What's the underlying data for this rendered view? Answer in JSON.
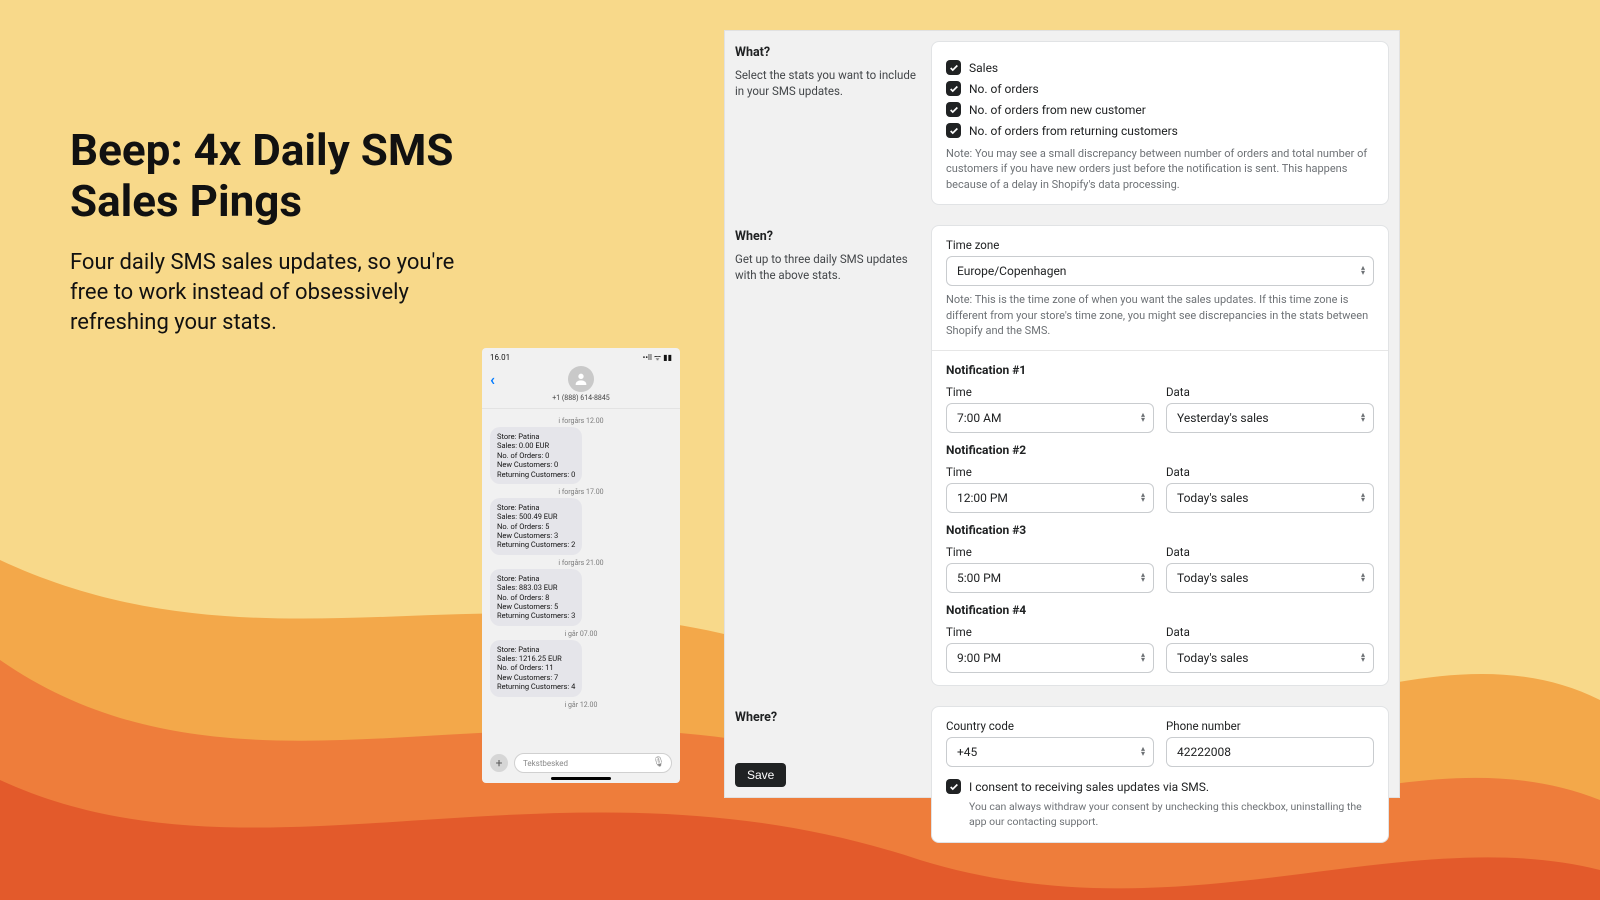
{
  "hero": {
    "title": "Beep: 4x Daily SMS Sales Pings",
    "subtitle": "Four daily SMS sales updates, so you're free to work instead of obsessively refreshing your stats."
  },
  "phone": {
    "status_time": "16.01",
    "number": "+1 (888) 614-8845",
    "input_placeholder": "Tekstbesked",
    "messages": [
      {
        "divider": "i forgårs 12.00",
        "lines": [
          "Store: Patina",
          "Sales: 0.00 EUR",
          "No. of Orders: 0",
          "New Customers: 0",
          "Returning Customers: 0"
        ]
      },
      {
        "divider": "i forgårs 17.00",
        "lines": [
          "Store: Patina",
          "Sales: 500.49 EUR",
          "No. of Orders: 5",
          "New Customers: 3",
          "Returning Customers: 2"
        ]
      },
      {
        "divider": "i forgårs 21.00",
        "lines": [
          "Store: Patina",
          "Sales: 883.03 EUR",
          "No. of Orders: 8",
          "New Customers: 5",
          "Returning Customers: 3"
        ]
      },
      {
        "divider": "i går 07.00",
        "lines": [
          "Store: Patina",
          "Sales: 1216.25 EUR",
          "No. of Orders: 11",
          "New Customers: 7",
          "Returning Customers: 4"
        ]
      },
      {
        "divider": "i går 12.00",
        "lines": []
      }
    ]
  },
  "panel": {
    "what": {
      "title": "What?",
      "help": "Select the stats you want to include in your SMS updates.",
      "options": [
        "Sales",
        "No. of orders",
        "No. of orders from new customer",
        "No. of orders from returning customers"
      ],
      "note": "Note: You may see a small discrepancy between number of orders and total number of customers if you have new orders just before the notification is sent. This happens because of a delay in Shopify's data processing."
    },
    "when": {
      "title": "When?",
      "help": "Get up to three daily SMS updates with the above stats.",
      "tz_label": "Time zone",
      "tz_value": "Europe/Copenhagen",
      "tz_note": "Note: This is the time zone of when you want the sales updates. If this time zone is different from your store's time zone, you might see discrepancies in the stats between Shopify and the SMS.",
      "time_label": "Time",
      "data_label": "Data",
      "notifications": [
        {
          "heading": "Notification #1",
          "time": "7:00 AM",
          "data": "Yesterday's sales"
        },
        {
          "heading": "Notification #2",
          "time": "12:00 PM",
          "data": "Today's sales"
        },
        {
          "heading": "Notification #3",
          "time": "5:00 PM",
          "data": "Today's sales"
        },
        {
          "heading": "Notification #4",
          "time": "9:00 PM",
          "data": "Today's sales"
        }
      ]
    },
    "where": {
      "title": "Where?",
      "cc_label": "Country code",
      "cc_value": "+45",
      "phone_label": "Phone number",
      "phone_value": "42222008",
      "consent": "I consent to receiving sales updates via SMS.",
      "consent_sub": "You can always withdraw your consent by unchecking this checkbox, uninstalling the app our contacting support."
    },
    "save_label": "Save"
  }
}
